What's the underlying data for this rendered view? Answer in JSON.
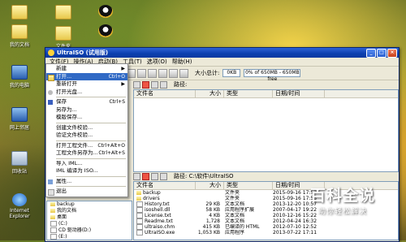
{
  "desktop": {
    "icons": [
      {
        "label": "我的文档"
      },
      {
        "label": "我的电脑"
      },
      {
        "label": "网上邻居"
      },
      {
        "label": "回收站"
      },
      {
        "label": "Internet Explorer"
      },
      {
        "label": "文件夹"
      }
    ]
  },
  "window": {
    "title": "UltraISO (试用版)",
    "menubar": [
      "文件(F)",
      "操作(A)",
      "启动(B)",
      "工具(T)",
      "选项(O)",
      "帮助(H)"
    ],
    "size_label": "大小总计:",
    "size_value": "0KB",
    "size_bar": "0% of 650MB - 650MB free",
    "path_label": "路径:",
    "path_label_lower": "路径: C:\\软件\\UltraISO",
    "columns": {
      "name": "文件名",
      "size": "大小",
      "type": "类型",
      "date": "日期/时间"
    },
    "upper_rows": [],
    "lower_rows": [
      {
        "name": "backup",
        "size": "",
        "type": "文件夹",
        "date": "2015-09-16 17:53"
      },
      {
        "name": "drivers",
        "size": "",
        "type": "文件夹",
        "date": "2015-09-16 17:53"
      },
      {
        "name": "History.txt",
        "size": "29 KB",
        "type": "文本文档",
        "date": "2013-12-20 10:57"
      },
      {
        "name": "isoshell.dll",
        "size": "58 KB",
        "type": "应用程序扩展",
        "date": "2007-04-17 19:22"
      },
      {
        "name": "License.txt",
        "size": "4 KB",
        "type": "文本文档",
        "date": "2010-12-16 15:22"
      },
      {
        "name": "Readme.txt",
        "size": "1,728",
        "type": "文本文档",
        "date": "2012-04-24 16:32"
      },
      {
        "name": "ultraiso.chm",
        "size": "415 KB",
        "type": "已编译的 HTML",
        "date": "2012-07-10 12:52"
      },
      {
        "name": "UltraISO.exe",
        "size": "1,053 KB",
        "type": "应用程序",
        "date": "2013-07-22 17:11"
      }
    ],
    "tree": [
      "backup",
      "我的文档",
      "桌面",
      "(C:)",
      "CD 驱动器(D:)",
      "(E:)"
    ]
  },
  "file_menu": {
    "items": [
      {
        "label": "新建",
        "shortcut": "",
        "submenu": true
      },
      {
        "label": "打开...",
        "shortcut": "Ctrl+O",
        "highlight": true
      },
      {
        "label": "重新打开",
        "shortcut": "",
        "submenu": true
      },
      {
        "label": "打开光盘...",
        "shortcut": ""
      },
      {
        "label": "保存",
        "shortcut": "Ctrl+S"
      },
      {
        "label": "另存为...",
        "shortcut": ""
      },
      {
        "label": "模版保存...",
        "shortcut": ""
      },
      {
        "label": "创建文件校验...",
        "shortcut": ""
      },
      {
        "label": "验证文件校验...",
        "shortcut": ""
      },
      {
        "label": "打开工程文件...",
        "shortcut": "Ctrl+Alt+O"
      },
      {
        "label": "工程文件另存为...",
        "shortcut": "Ctrl+Alt+S"
      },
      {
        "label": "导入 IML...",
        "shortcut": ""
      },
      {
        "label": "IML 编译为 ISO...",
        "shortcut": ""
      },
      {
        "label": "属性...",
        "shortcut": ""
      },
      {
        "label": "退出",
        "shortcut": ""
      }
    ]
  },
  "watermark": {
    "big": "百科全说",
    "small": "助你轻松解决"
  },
  "colors": {
    "title_bar": "#0b3fae",
    "menu_highlight": "#316ac5"
  }
}
